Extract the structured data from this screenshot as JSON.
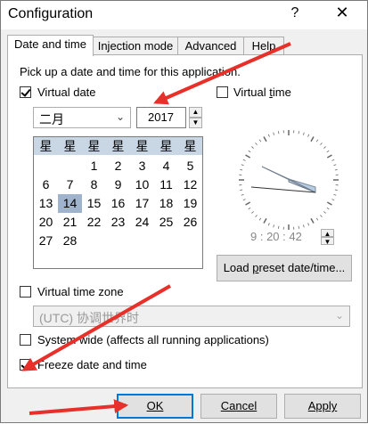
{
  "window": {
    "title": "Configuration",
    "help_glyph": "?",
    "close_glyph": "✕"
  },
  "tabs": [
    {
      "label": "Date and time",
      "active": true
    },
    {
      "label": "Injection mode",
      "active": false
    },
    {
      "label": "Advanced",
      "active": false
    },
    {
      "label": "Help",
      "active": false
    }
  ],
  "panel": {
    "intro": "Pick up a date and time for this application.",
    "virtual_date": {
      "label": "Virtual date",
      "checked": true
    },
    "virtual_time": {
      "label": "Virtual time",
      "checked": false
    },
    "month_select": {
      "value": "二月"
    },
    "year_input": {
      "value": "2017"
    },
    "calendar": {
      "weekday_headers": [
        "星",
        "星",
        "星",
        "星",
        "星",
        "星",
        "星"
      ],
      "weeks": [
        [
          "",
          "",
          "",
          "1",
          "2",
          "3",
          "4",
          "5"
        ],
        [
          "6",
          "7",
          "8",
          "9",
          "10",
          "11",
          "12"
        ],
        [
          "13",
          "14",
          "15",
          "16",
          "17",
          "18",
          "19"
        ],
        [
          "20",
          "21",
          "22",
          "23",
          "24",
          "25",
          "26"
        ],
        [
          "27",
          "28",
          "",
          "",
          "",
          "",
          ""
        ]
      ],
      "selected_day": "14"
    },
    "clock_readout": "9 : 20 : 42",
    "load_preset_button": "Load preset date/time...",
    "virtual_timezone": {
      "label": "Virtual time zone",
      "checked": false
    },
    "timezone_select": {
      "value": "(UTC) 协调世界时"
    },
    "system_wide": {
      "label": "System wide (affects all running applications)",
      "checked": false
    },
    "freeze": {
      "label": "Freeze date and time",
      "checked": true
    }
  },
  "footer": {
    "ok": "OK",
    "cancel": "Cancel",
    "apply": "Apply"
  },
  "colors": {
    "arrow": "#e8302a",
    "selection": "#9fb3cc",
    "calendar_header": "#c9d6e3",
    "focus": "#0078d7"
  }
}
